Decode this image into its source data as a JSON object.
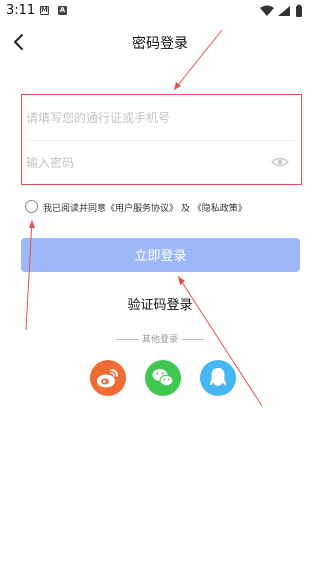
{
  "status_bar": {
    "time": "3:11",
    "icon_m": "M",
    "icon_a": "A"
  },
  "header": {
    "title": "密码登录"
  },
  "form": {
    "account_placeholder": "请填写您的通行证或手机号",
    "password_placeholder": "输入密码"
  },
  "agreement": {
    "text": "我已阅读并同意《用户服务协议》 及 《隐私政策》"
  },
  "login_button": "立即登录",
  "sms_login": "验证码登录",
  "other_login": "其他登录",
  "social": [
    "weibo-icon",
    "wechat-icon",
    "qq-icon"
  ],
  "colors": {
    "login_button": "#9db8f8",
    "weibo": "#f16b35",
    "wechat": "#3ec850",
    "qq": "#45b7f2",
    "annotation": "#e05252"
  }
}
